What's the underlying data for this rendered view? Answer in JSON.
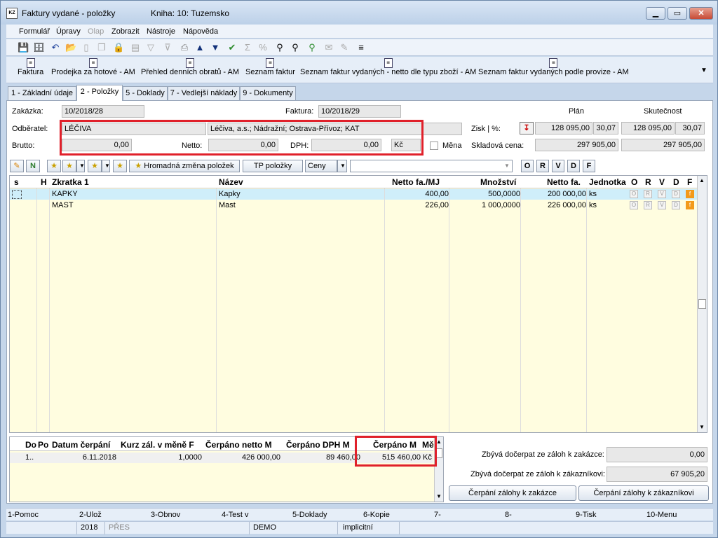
{
  "window": {
    "title": "Faktury vydané - položky",
    "book": "Kniha: 10: Tuzemsko",
    "icon_text": "KZ"
  },
  "menu": {
    "items": [
      "Formulář",
      "Úpravy",
      "Olap",
      "Zobrazit",
      "Nástroje",
      "Nápověda"
    ]
  },
  "ribbon": {
    "items": [
      "Faktura",
      "Prodejka za hotové - AM",
      "Přehled denních obratů - AM",
      "Seznam faktur",
      "Seznam faktur vydaných - netto dle typu zboží - AM",
      "Seznam faktur vydaných podle provize - AM"
    ]
  },
  "tabs": [
    "1 - Základní údaje",
    "2 - Položky",
    "5 - Doklady",
    "7 - Vedlejší náklady",
    "9 - Dokumenty"
  ],
  "header": {
    "zakazka_label": "Zakázka:",
    "zakazka": "10/2018/28",
    "faktura_label": "Faktura:",
    "faktura": "10/2018/29",
    "odberatel_label": "Odběratel:",
    "odberatel_code": "LÉČIVA",
    "odberatel_name": "Léčiva, a.s.; Nádražní; Ostrava-Přívoz; KAT",
    "brutto_label": "Brutto:",
    "brutto": "0,00",
    "netto_label": "Netto:",
    "netto": "0,00",
    "dph_label": "DPH:",
    "dph": "0,00",
    "currency": "Kč",
    "mena_label": "Měna",
    "plan_label": "Plán",
    "skutecnost_label": "Skutečnost",
    "zisk_label": "Zisk | %:",
    "zisk_plan": "128 095,00",
    "zisk_plan_pct": "30,07",
    "zisk_skut": "128 095,00",
    "zisk_skut_pct": "30,07",
    "sklad_label": "Skladová cena:",
    "sklad_plan": "297 905,00",
    "sklad_skut": "297 905,00"
  },
  "grid_toolbar": {
    "mass_change": "Hromadná změna položek",
    "tp_items": "TP položky",
    "prices": "Ceny",
    "letters": [
      "O",
      "R",
      "V",
      "D",
      "F"
    ]
  },
  "items_grid": {
    "headers": {
      "s": "s",
      "h": "H",
      "code": "Zkratka 1",
      "name": "Název",
      "netto_mj": "Netto fa./MJ",
      "qty": "Množství",
      "netto": "Netto fa.",
      "unit": "Jednotka",
      "o": "O",
      "r": "R",
      "v": "V",
      "d": "D",
      "f": "F"
    },
    "rows": [
      {
        "code": "KAPKY",
        "name": "Kapky",
        "netto_mj": "400,00",
        "qty": "500,0000",
        "netto": "200 000,00",
        "unit": "ks"
      },
      {
        "code": "MAST",
        "name": "Mast",
        "netto_mj": "226,00",
        "qty": "1 000,0000",
        "netto": "226 000,00",
        "unit": "ks"
      }
    ]
  },
  "advance_grid": {
    "headers": {
      "do": "Do",
      "po": "Po",
      "datum": "Datum čerpání",
      "kurz": "Kurz zál. v měně F",
      "netto": "Čerpáno netto M",
      "dph": "Čerpáno DPH M",
      "cerpano": "Čerpáno M",
      "me": "Mě"
    },
    "row": {
      "do": "1..",
      "datum": "6.11.2018",
      "kurz": "1,0000",
      "netto": "426 000,00",
      "dph": "89 460,00",
      "cerpano": "515 460,00",
      "me": "Kč"
    }
  },
  "advance_summary": {
    "zakazka_label": "Zbývá dočerpat ze záloh k zakázce:",
    "zakazka_value": "0,00",
    "zakaznik_label": "Zbývá dočerpat ze záloh k zákazníkovi:",
    "zakaznik_value": "67 905,20",
    "btn_zakazka": "Čerpání zálohy k zakázce",
    "btn_zakaznik": "Čerpání zálohy k zákazníkovi"
  },
  "fkeys": [
    "1-Pomoc",
    "2-Ulož",
    "3-Obnov",
    "4-Test v",
    "5-Doklady",
    "6-Kopie",
    "7-",
    "8-",
    "9-Tisk",
    "10-Menu"
  ],
  "status": {
    "year": "2018",
    "mode": "PŘES",
    "db": "DEMO",
    "profile": "implicitní"
  }
}
